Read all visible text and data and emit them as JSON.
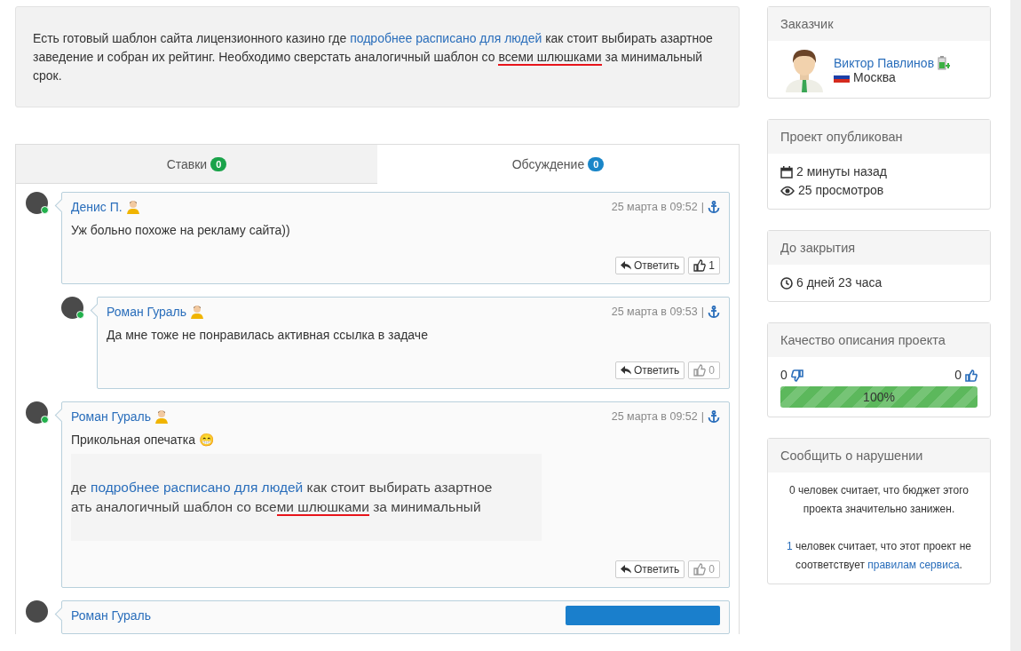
{
  "description": {
    "segments": [
      {
        "kind": "plain",
        "text": "Есть готовый шаблон сайта лицензионного казино где "
      },
      {
        "kind": "link",
        "text": "подробнее расписано для людей"
      },
      {
        "kind": "plain",
        "text": " как стоит выбирать азартное заведение и собран их рейтинг. Необходимо сверстать аналогичный шаблон со "
      },
      {
        "kind": "marked",
        "text": "всеми шлюшками"
      },
      {
        "kind": "plain",
        "text": " за минимальный срок."
      }
    ]
  },
  "tabs": [
    {
      "label": "Ставки",
      "count": "0",
      "color": "#1aa34a",
      "selected": false
    },
    {
      "label": "Обсуждение",
      "count": "0",
      "color": "#1a86c8",
      "selected": true
    }
  ],
  "comments": [
    {
      "kind": "full",
      "author": "Денис П.",
      "online": true,
      "time": "25 марта в 09:52",
      "separator": "|",
      "text": "Уж больно похоже на рекламу сайта))",
      "reply": "Ответить",
      "likes": "1",
      "liked": true,
      "children": [
        {
          "kind": "full",
          "author": "Роман Гураль",
          "online": true,
          "time": "25 марта в 09:53",
          "separator": "|",
          "text": "Да мне тоже не понравилась активная ссылка в задаче",
          "reply": "Ответить",
          "likes": "0",
          "liked": false
        }
      ]
    },
    {
      "kind": "full",
      "author": "Роман Гураль",
      "online": true,
      "time": "25 марта в 09:52",
      "separator": "|",
      "text": "Прикольная опечатка 😁",
      "reply": "Ответить",
      "likes": "0",
      "liked": false,
      "screenshot": [
        [
          {
            "kind": "plain",
            "text": "де "
          },
          {
            "kind": "link",
            "text": "подробнее расписано для людей"
          },
          {
            "kind": "plain",
            "text": " как стоит выбирать азартное"
          }
        ],
        [
          {
            "kind": "plain",
            "text": "ать аналогичный шаблон со все"
          },
          {
            "kind": "marked",
            "text": "ми шлюшками"
          },
          {
            "kind": "plain",
            "text": " за минимальный"
          }
        ]
      ]
    },
    {
      "kind": "partial",
      "author": "Роман Гураль"
    }
  ],
  "sidebar": {
    "customer": {
      "title": "Заказчик",
      "name": "Виктор Павлинов",
      "city": "Москва"
    },
    "published": {
      "title": "Проект опубликован",
      "ago": "2 минуты назад",
      "views": "25 просмотров"
    },
    "closing": {
      "title": "До закрытия",
      "remaining": "6 дней 23 часа"
    },
    "quality": {
      "title": "Качество описания проекта",
      "dislikes": "0",
      "likes": "0",
      "level": 1,
      "reading": "100%"
    },
    "report": {
      "title": "Сообщить о нарушении",
      "line_1": "0 человек считает, что бюджет этого проекта значительно занижен.",
      "line_2_count": "1",
      "line_2_text": " человек считает, что этот проект не соответствует ",
      "line_2_link": "правилам сервиса",
      "line_2_end": "."
    }
  }
}
